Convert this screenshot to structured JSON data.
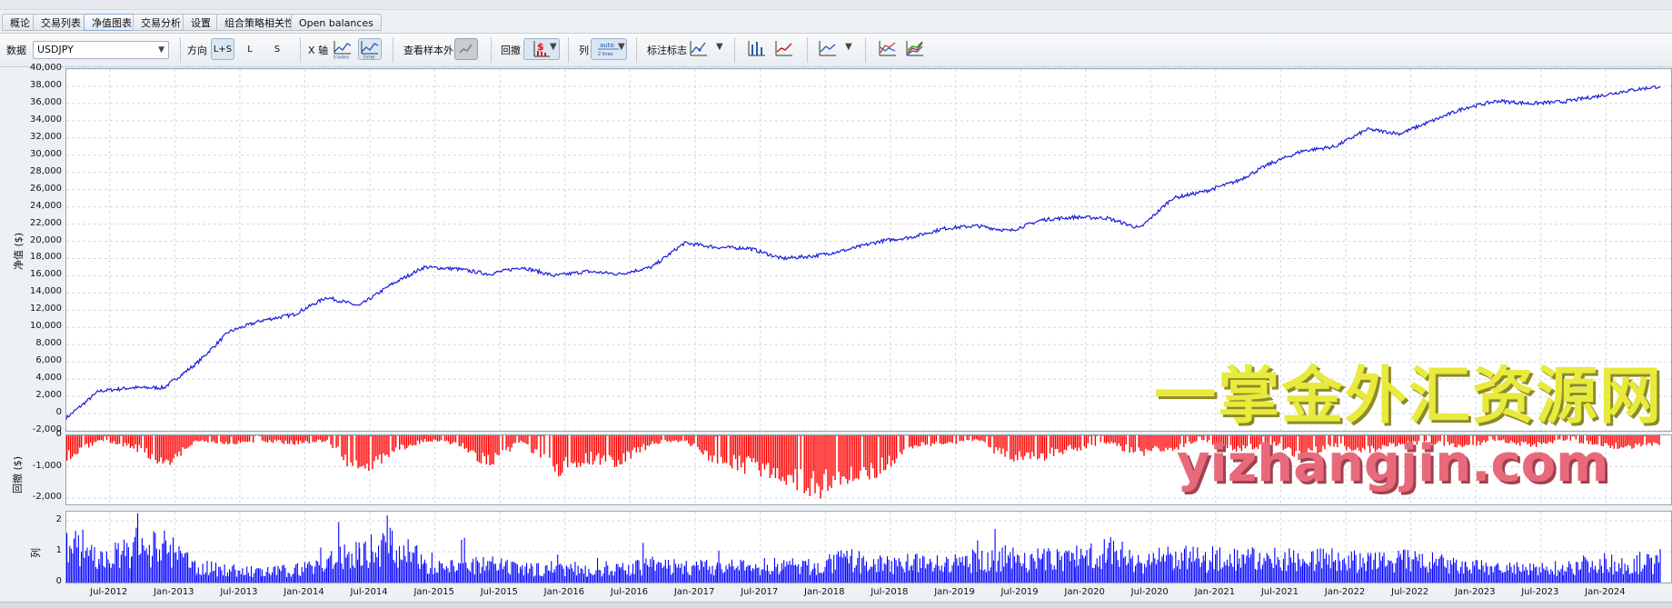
{
  "tabs": [
    {
      "label": "概论"
    },
    {
      "label": "交易列表"
    },
    {
      "label": "净值图表",
      "active": true
    },
    {
      "label": "交易分析"
    },
    {
      "label": "设置"
    },
    {
      "label": "组合策略相关性"
    },
    {
      "label": "Open balances"
    }
  ],
  "toolbar": {
    "data_label": "数据",
    "data_value": "USDJPY",
    "direction_label": "方向",
    "direction_options": [
      "L+S",
      "L",
      "S"
    ],
    "xaxis_label": "X 轴",
    "xaxis_trades": "trades",
    "xaxis_time": "time",
    "out_of_sample_label": "查看样本外",
    "drawdown_label": "回撤",
    "drawdown_unit": "$",
    "column_label": "列",
    "column_value": "auto",
    "column_sub": "2 lines",
    "mark_label": "标注标志"
  },
  "equity_panel": {
    "ylabel": "净值 ($)",
    "yticks": [
      "40,000",
      "38,000",
      "36,000",
      "34,000",
      "32,000",
      "30,000",
      "28,000",
      "26,000",
      "24,000",
      "22,000",
      "20,000",
      "18,000",
      "16,000",
      "14,000",
      "12,000",
      "10,000",
      "8,000",
      "6,000",
      "4,000",
      "2,000",
      "0",
      "-2,000"
    ]
  },
  "drawdown_panel": {
    "ylabel": "回撤 ($)",
    "yticks": [
      "0",
      "-1,000",
      "-2,000"
    ]
  },
  "column_panel": {
    "ylabel": "列",
    "yticks": [
      "2",
      "1",
      "0"
    ]
  },
  "xticks": [
    "Jul-2012",
    "Jan-2013",
    "Jul-2013",
    "Jan-2014",
    "Jul-2014",
    "Jan-2015",
    "Jul-2015",
    "Jan-2016",
    "Jul-2016",
    "Jan-2017",
    "Jul-2017",
    "Jan-2018",
    "Jul-2018",
    "Jan-2019",
    "Jul-2019",
    "Jan-2020",
    "Jul-2020",
    "Jan-2021",
    "Jul-2021",
    "Jan-2022",
    "Jul-2022",
    "Jan-2023",
    "Jul-2023",
    "Jan-2024"
  ],
  "watermark": {
    "cn": "一掌金外汇资源网",
    "url": "yizhangjin.com"
  },
  "colors": {
    "equity_line": "#1c1cd9",
    "drawdown_bars": "#ff0000",
    "column_bars": "#0000ff"
  },
  "chart_data": [
    {
      "type": "line",
      "title": "",
      "xlabel": "",
      "ylabel": "净值 ($)",
      "ylim": [
        -2000,
        40000
      ],
      "x": [
        "2012-03",
        "2012-06",
        "2012-09",
        "2012-12",
        "2013-03",
        "2013-06",
        "2013-09",
        "2013-12",
        "2014-03",
        "2014-06",
        "2014-09",
        "2014-12",
        "2015-03",
        "2015-06",
        "2015-09",
        "2015-12",
        "2016-03",
        "2016-06",
        "2016-09",
        "2016-12",
        "2017-03",
        "2017-06",
        "2017-09",
        "2017-12",
        "2018-03",
        "2018-06",
        "2018-09",
        "2018-12",
        "2019-03",
        "2019-06",
        "2019-09",
        "2019-12",
        "2020-03",
        "2020-06",
        "2020-09",
        "2020-12",
        "2021-03",
        "2021-06",
        "2021-09",
        "2021-12",
        "2022-03",
        "2022-06",
        "2022-09",
        "2022-12",
        "2023-03",
        "2023-06",
        "2023-09",
        "2023-12",
        "2024-03",
        "2024-06"
      ],
      "series": [
        {
          "values": [
            -500,
            2600,
            3000,
            3000,
            5800,
            9500,
            10800,
            11500,
            13500,
            12500,
            15000,
            17000,
            16800,
            16200,
            17000,
            16000,
            16500,
            16200,
            17000,
            19800,
            19300,
            19200,
            18000,
            18300,
            19000,
            20000,
            20500,
            21500,
            21800,
            21200,
            22500,
            22800,
            22700,
            21500,
            25000,
            25800,
            27000,
            29000,
            30500,
            31000,
            33000,
            32500,
            34000,
            35500,
            36300,
            36000,
            36200,
            36800,
            37500,
            38000
          ]
        }
      ]
    },
    {
      "type": "bar",
      "title": "",
      "xlabel": "",
      "ylabel": "回撤 ($)",
      "ylim": [
        -2200,
        0
      ],
      "x": [
        "2012-03",
        "2012-06",
        "2012-09",
        "2012-12",
        "2013-03",
        "2013-06",
        "2013-09",
        "2013-12",
        "2014-03",
        "2014-06",
        "2014-09",
        "2014-12",
        "2015-03",
        "2015-06",
        "2015-09",
        "2015-12",
        "2016-03",
        "2016-06",
        "2016-09",
        "2016-12",
        "2017-03",
        "2017-06",
        "2017-09",
        "2017-12",
        "2018-03",
        "2018-06",
        "2018-09",
        "2018-12",
        "2019-03",
        "2019-06",
        "2019-09",
        "2019-12",
        "2020-03",
        "2020-06",
        "2020-09",
        "2020-12",
        "2021-03",
        "2021-06",
        "2021-09",
        "2021-12",
        "2022-03",
        "2022-06",
        "2022-09",
        "2022-12",
        "2023-03",
        "2023-06",
        "2023-09",
        "2023-12",
        "2024-03",
        "2024-06"
      ],
      "series": [
        {
          "values": [
            -800,
            -200,
            -400,
            -1100,
            -200,
            -300,
            -200,
            -300,
            -200,
            -1500,
            -600,
            -200,
            -300,
            -1100,
            -200,
            -1400,
            -900,
            -1000,
            -300,
            -200,
            -1000,
            -1200,
            -1500,
            -2000,
            -1700,
            -1300,
            -400,
            -300,
            -200,
            -900,
            -800,
            -500,
            -300,
            -700,
            -500,
            -200,
            -600,
            -300,
            -800,
            -400,
            -600,
            -300,
            -300,
            -400,
            -200,
            -400,
            -200,
            -300,
            -500,
            -300
          ]
        }
      ]
    },
    {
      "type": "bar",
      "title": "",
      "xlabel": "",
      "ylabel": "列",
      "ylim": [
        0,
        2.3
      ],
      "x": [
        "2012-03",
        "2012-06",
        "2012-09",
        "2012-12",
        "2013-03",
        "2013-06",
        "2013-09",
        "2013-12",
        "2014-03",
        "2014-06",
        "2014-09",
        "2014-12",
        "2015-03",
        "2015-06",
        "2015-09",
        "2015-12",
        "2016-03",
        "2016-06",
        "2016-09",
        "2016-12",
        "2017-03",
        "2017-06",
        "2017-09",
        "2017-12",
        "2018-03",
        "2018-06",
        "2018-09",
        "2018-12",
        "2019-03",
        "2019-06",
        "2019-09",
        "2019-12",
        "2020-03",
        "2020-06",
        "2020-09",
        "2020-12",
        "2021-03",
        "2021-06",
        "2021-09",
        "2021-12",
        "2022-03",
        "2022-06",
        "2022-09",
        "2022-12",
        "2023-03",
        "2023-06",
        "2023-09",
        "2023-12",
        "2024-03",
        "2024-06"
      ],
      "series": [
        {
          "values": [
            1.6,
            0.9,
            1.2,
            1.4,
            0.6,
            0.5,
            0.4,
            0.5,
            0.8,
            1.2,
            1.5,
            0.8,
            0.6,
            0.7,
            0.5,
            0.6,
            0.5,
            0.5,
            0.7,
            0.6,
            0.6,
            0.6,
            0.7,
            0.6,
            0.9,
            0.7,
            0.8,
            0.7,
            0.9,
            1.0,
            0.9,
            1.0,
            1.3,
            0.8,
            1.0,
            0.9,
            1.0,
            0.9,
            1.0,
            0.9,
            0.8,
            0.9,
            0.8,
            0.6,
            0.6,
            0.5,
            0.6,
            0.8,
            0.7,
            0.8
          ]
        }
      ]
    }
  ]
}
